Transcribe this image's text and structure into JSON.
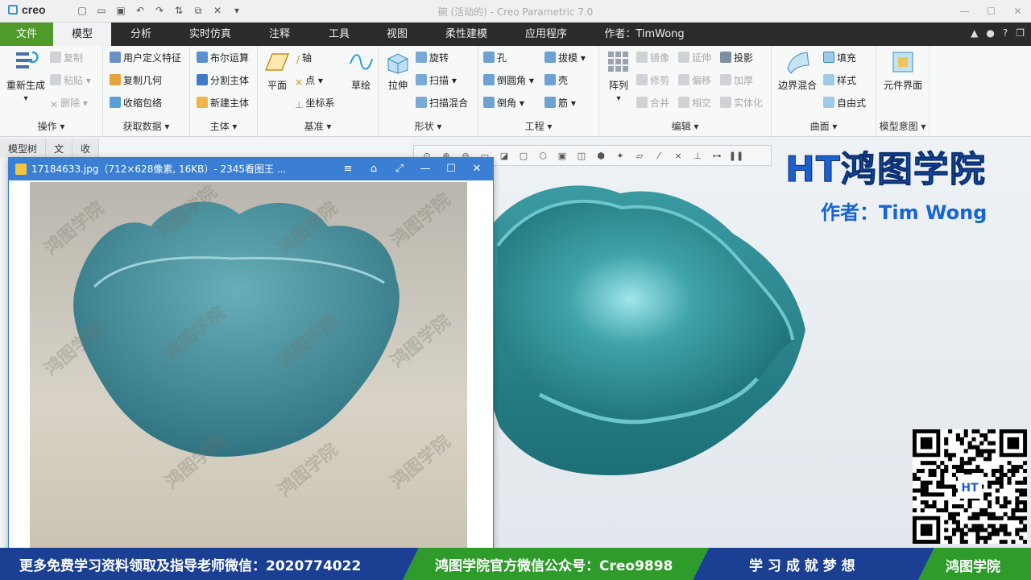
{
  "app": {
    "logo": "creo",
    "title": "碗 (活动的) - Creo Parametric 7.0"
  },
  "tabs": [
    {
      "label": "文件"
    },
    {
      "label": "模型"
    },
    {
      "label": "分析"
    },
    {
      "label": "实时仿真"
    },
    {
      "label": "注释"
    },
    {
      "label": "工具"
    },
    {
      "label": "视图"
    },
    {
      "label": "柔性建模"
    },
    {
      "label": "应用程序"
    },
    {
      "label": "作者：TimWong"
    }
  ],
  "ribbon": {
    "operations": {
      "label": "操作",
      "regen": "重新生成",
      "copy": "复制",
      "paste": "粘贴",
      "delete": "删除"
    },
    "getdata": {
      "label": "获取数据",
      "udf": "用户定义特征",
      "copygeom": "复制几何",
      "shrinkwrap": "收缩包络"
    },
    "body": {
      "label": "主体",
      "boolean": "布尔运算",
      "split": "分割主体",
      "newbody": "新建主体"
    },
    "datum": {
      "label": "基准",
      "plane": "平面",
      "axis": "轴",
      "point": "点",
      "csys": "坐标系",
      "sketch": "草绘"
    },
    "shapes": {
      "label": "形状",
      "extrude": "拉伸",
      "revolve": "旋转",
      "sweep": "扫描",
      "sweepblend": "扫描混合"
    },
    "engineering": {
      "label": "工程",
      "hole": "孔",
      "round": "倒圆角",
      "chamfer": "倒角",
      "draft": "拔模",
      "shell": "壳",
      "rib": "筋"
    },
    "editing": {
      "label": "编辑",
      "pattern": "阵列",
      "mirror": "镜像",
      "trim": "修剪",
      "merge": "合并",
      "extend": "延伸",
      "offset": "偏移",
      "intersect": "相交",
      "project": "投影",
      "thicken": "加厚",
      "solidify": "实体化"
    },
    "surfaces": {
      "label": "曲面",
      "boundary": "边界混合",
      "fill": "填充",
      "style": "样式",
      "freestyle": "自由式"
    },
    "modelintent": {
      "label": "模型意图",
      "component": "元件界面"
    }
  },
  "lefttabs": [
    "模型树",
    "文",
    "收"
  ],
  "viewer": {
    "title": "17184633.jpg（712×628像素, 16KB）- 2345看图王 ...",
    "watermark": "鸿图学院"
  },
  "brand": {
    "name": "鸿图学院",
    "author": "作者：Tim Wong"
  },
  "banner": {
    "left": "更多免费学习资料领取及指导老师微信：2020774022",
    "mid": "鸿图学院官方微信公众号：Creo9898",
    "slogan": "学 习 成 就 梦 想",
    "right": "鸿图学院"
  },
  "colors": {
    "file_tab": "#4f9a2a",
    "bowl": "#2f8d95",
    "brand_blue": "#1565d8"
  }
}
